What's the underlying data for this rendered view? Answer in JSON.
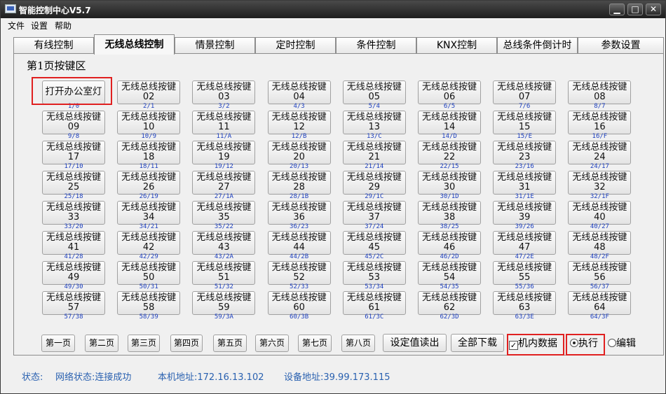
{
  "window": {
    "title": "智能控制中心V5.7",
    "buttons": [
      "▁",
      "□",
      "✕"
    ]
  },
  "menu": [
    "文件",
    "设置",
    "帮助"
  ],
  "tabs": [
    "有线控制",
    "无线总线控制",
    "情景控制",
    "定时控制",
    "条件控制",
    "KNX控制",
    "总线条件倒计时",
    "参数设置"
  ],
  "active_tab": 1,
  "group_label": "第1页按键区",
  "keys": [
    {
      "label": "打开办公室灯",
      "addr": "1/0",
      "special": true
    },
    {
      "label": "无线总线按键",
      "num": "02",
      "addr": "2/1"
    },
    {
      "label": "无线总线按键",
      "num": "03",
      "addr": "3/2"
    },
    {
      "label": "无线总线按键",
      "num": "04",
      "addr": "4/3"
    },
    {
      "label": "无线总线按键",
      "num": "05",
      "addr": "5/4"
    },
    {
      "label": "无线总线按键",
      "num": "06",
      "addr": "6/5"
    },
    {
      "label": "无线总线按键",
      "num": "07",
      "addr": "7/6"
    },
    {
      "label": "无线总线按键",
      "num": "08",
      "addr": "8/7"
    },
    {
      "label": "无线总线按键",
      "num": "09",
      "addr": "9/8"
    },
    {
      "label": "无线总线按键",
      "num": "10",
      "addr": "10/9"
    },
    {
      "label": "无线总线按键",
      "num": "11",
      "addr": "11/A"
    },
    {
      "label": "无线总线按键",
      "num": "12",
      "addr": "12/B"
    },
    {
      "label": "无线总线按键",
      "num": "13",
      "addr": "13/C"
    },
    {
      "label": "无线总线按键",
      "num": "14",
      "addr": "14/D"
    },
    {
      "label": "无线总线按键",
      "num": "15",
      "addr": "15/E"
    },
    {
      "label": "无线总线按键",
      "num": "16",
      "addr": "16/F"
    },
    {
      "label": "无线总线按键",
      "num": "17",
      "addr": "17/10"
    },
    {
      "label": "无线总线按键",
      "num": "18",
      "addr": "18/11"
    },
    {
      "label": "无线总线按键",
      "num": "19",
      "addr": "19/12"
    },
    {
      "label": "无线总线按键",
      "num": "20",
      "addr": "20/13"
    },
    {
      "label": "无线总线按键",
      "num": "21",
      "addr": "21/14"
    },
    {
      "label": "无线总线按键",
      "num": "22",
      "addr": "22/15"
    },
    {
      "label": "无线总线按键",
      "num": "23",
      "addr": "23/16"
    },
    {
      "label": "无线总线按键",
      "num": "24",
      "addr": "24/17"
    },
    {
      "label": "无线总线按键",
      "num": "25",
      "addr": "25/18"
    },
    {
      "label": "无线总线按键",
      "num": "26",
      "addr": "26/19"
    },
    {
      "label": "无线总线按键",
      "num": "27",
      "addr": "27/1A"
    },
    {
      "label": "无线总线按键",
      "num": "28",
      "addr": "28/1B"
    },
    {
      "label": "无线总线按键",
      "num": "29",
      "addr": "29/1C"
    },
    {
      "label": "无线总线按键",
      "num": "30",
      "addr": "30/1D"
    },
    {
      "label": "无线总线按键",
      "num": "31",
      "addr": "31/1E"
    },
    {
      "label": "无线总线按键",
      "num": "32",
      "addr": "32/1F"
    },
    {
      "label": "无线总线按键",
      "num": "33",
      "addr": "33/20"
    },
    {
      "label": "无线总线按键",
      "num": "34",
      "addr": "34/21"
    },
    {
      "label": "无线总线按键",
      "num": "35",
      "addr": "35/22"
    },
    {
      "label": "无线总线按键",
      "num": "36",
      "addr": "36/23"
    },
    {
      "label": "无线总线按键",
      "num": "37",
      "addr": "37/24"
    },
    {
      "label": "无线总线按键",
      "num": "38",
      "addr": "38/25"
    },
    {
      "label": "无线总线按键",
      "num": "39",
      "addr": "39/26"
    },
    {
      "label": "无线总线按键",
      "num": "40",
      "addr": "40/27"
    },
    {
      "label": "无线总线按键",
      "num": "41",
      "addr": "41/28"
    },
    {
      "label": "无线总线按键",
      "num": "42",
      "addr": "42/29"
    },
    {
      "label": "无线总线按键",
      "num": "43",
      "addr": "43/2A"
    },
    {
      "label": "无线总线按键",
      "num": "44",
      "addr": "44/2B"
    },
    {
      "label": "无线总线按键",
      "num": "45",
      "addr": "45/2C"
    },
    {
      "label": "无线总线按键",
      "num": "46",
      "addr": "46/2D"
    },
    {
      "label": "无线总线按键",
      "num": "47",
      "addr": "47/2E"
    },
    {
      "label": "无线总线按键",
      "num": "48",
      "addr": "48/2F"
    },
    {
      "label": "无线总线按键",
      "num": "49",
      "addr": "49/30"
    },
    {
      "label": "无线总线按键",
      "num": "50",
      "addr": "50/31"
    },
    {
      "label": "无线总线按键",
      "num": "51",
      "addr": "51/32"
    },
    {
      "label": "无线总线按键",
      "num": "52",
      "addr": "52/33"
    },
    {
      "label": "无线总线按键",
      "num": "53",
      "addr": "53/34"
    },
    {
      "label": "无线总线按键",
      "num": "54",
      "addr": "54/35"
    },
    {
      "label": "无线总线按键",
      "num": "55",
      "addr": "55/36"
    },
    {
      "label": "无线总线按键",
      "num": "56",
      "addr": "56/37"
    },
    {
      "label": "无线总线按键",
      "num": "57",
      "addr": "57/38"
    },
    {
      "label": "无线总线按键",
      "num": "58",
      "addr": "58/39"
    },
    {
      "label": "无线总线按键",
      "num": "59",
      "addr": "59/3A"
    },
    {
      "label": "无线总线按键",
      "num": "60",
      "addr": "60/3B"
    },
    {
      "label": "无线总线按键",
      "num": "61",
      "addr": "61/3C"
    },
    {
      "label": "无线总线按键",
      "num": "62",
      "addr": "62/3D"
    },
    {
      "label": "无线总线按键",
      "num": "63",
      "addr": "63/3E"
    },
    {
      "label": "无线总线按键",
      "num": "64",
      "addr": "64/3F"
    }
  ],
  "pages": [
    "第一页",
    "第二页",
    "第三页",
    "第四页",
    "第五页",
    "第六页",
    "第七页",
    "第八页"
  ],
  "actions": {
    "read_settings": "设定值读出",
    "download_all": "全部下载"
  },
  "internal_data": {
    "label": "机内数据",
    "checked": true
  },
  "mode": {
    "execute": "执行",
    "edit": "编辑",
    "selected": "执行"
  },
  "status": {
    "label": "状态:",
    "network": "网络状态:连接成功",
    "local_addr": "本机地址:172.16.13.102",
    "device_addr": "设备地址:39.99.173.115"
  },
  "colors": {
    "highlight": "#e02020",
    "status_text": "#2a61b0",
    "addr_text": "#1c3fbf"
  }
}
